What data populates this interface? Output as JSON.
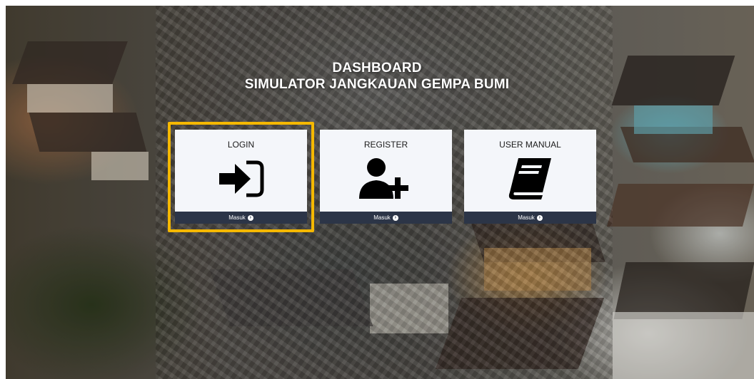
{
  "header": {
    "line1": "DASHBOARD",
    "line2": "SIMULATOR JANGKAUAN GEMPA BUMI"
  },
  "cards": [
    {
      "title": "LOGIN",
      "icon": "sign-in-icon",
      "footer": "Masuk"
    },
    {
      "title": "REGISTER",
      "icon": "user-plus-icon",
      "footer": "Masuk"
    },
    {
      "title": "USER MANUAL",
      "icon": "book-icon",
      "footer": "Masuk"
    }
  ],
  "colors": {
    "card_background": "#f4f6fa",
    "footer_background": "#2c3547",
    "highlight": "#f5b800",
    "header_text": "#ffffff"
  }
}
